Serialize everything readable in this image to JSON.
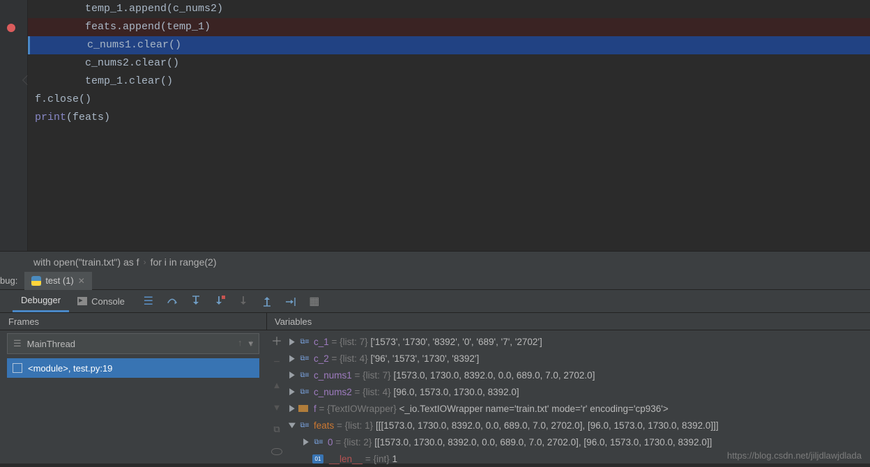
{
  "code": {
    "l1": "temp_1.append(c_nums2)",
    "l2": "feats.append(temp_1)",
    "l3": "c_nums1.clear()",
    "l4": "c_nums2.clear()",
    "l5": "temp_1.clear()",
    "l6": "f.close()",
    "l7_a": "print",
    "l7_b": "(feats)"
  },
  "breadcrumb": {
    "a": "with open(\"train.txt\") as f",
    "b": "for i in range(2)"
  },
  "run": {
    "bug_label": "bug:",
    "tab_name": "test (1)"
  },
  "dbg": {
    "tab_debugger": "Debugger",
    "tab_console": "Console"
  },
  "panels": {
    "frames": "Frames",
    "variables": "Variables"
  },
  "thread": {
    "name": "MainThread",
    "frame": "<module>, test.py:19"
  },
  "vars": {
    "c_1": {
      "name": "c_1",
      "type": " = {list: 7} ",
      "val": "['1573', '1730', '8392', '0', '689', '7', '2702']"
    },
    "c_2": {
      "name": "c_2",
      "type": " = {list: 4} ",
      "val": "['96', '1573', '1730', '8392']"
    },
    "c_nums1": {
      "name": "c_nums1",
      "type": " = {list: 7} ",
      "val": "[1573.0, 1730.0, 8392.0, 0.0, 689.0, 7.0, 2702.0]"
    },
    "c_nums2": {
      "name": "c_nums2",
      "type": " = {list: 4} ",
      "val": "[96.0, 1573.0, 1730.0, 8392.0]"
    },
    "f": {
      "name": "f",
      "type": " = {TextIOWrapper} ",
      "val": "<_io.TextIOWrapper name='train.txt' mode='r' encoding='cp936'>"
    },
    "feats": {
      "name": "feats",
      "type": " = {list: 1} ",
      "val": "[[[1573.0, 1730.0, 8392.0, 0.0, 689.0, 7.0, 2702.0], [96.0, 1573.0, 1730.0, 8392.0]]]"
    },
    "feats0": {
      "name": "0",
      "type": " = {list: 2} ",
      "val": "[[1573.0, 1730.0, 8392.0, 0.0, 689.0, 7.0, 2702.0], [96.0, 1573.0, 1730.0, 8392.0]]"
    },
    "len": {
      "name": "__len__",
      "type": " = {int} ",
      "val": "1"
    }
  },
  "watermark": "https://blog.csdn.net/jiljdlawjdlada"
}
